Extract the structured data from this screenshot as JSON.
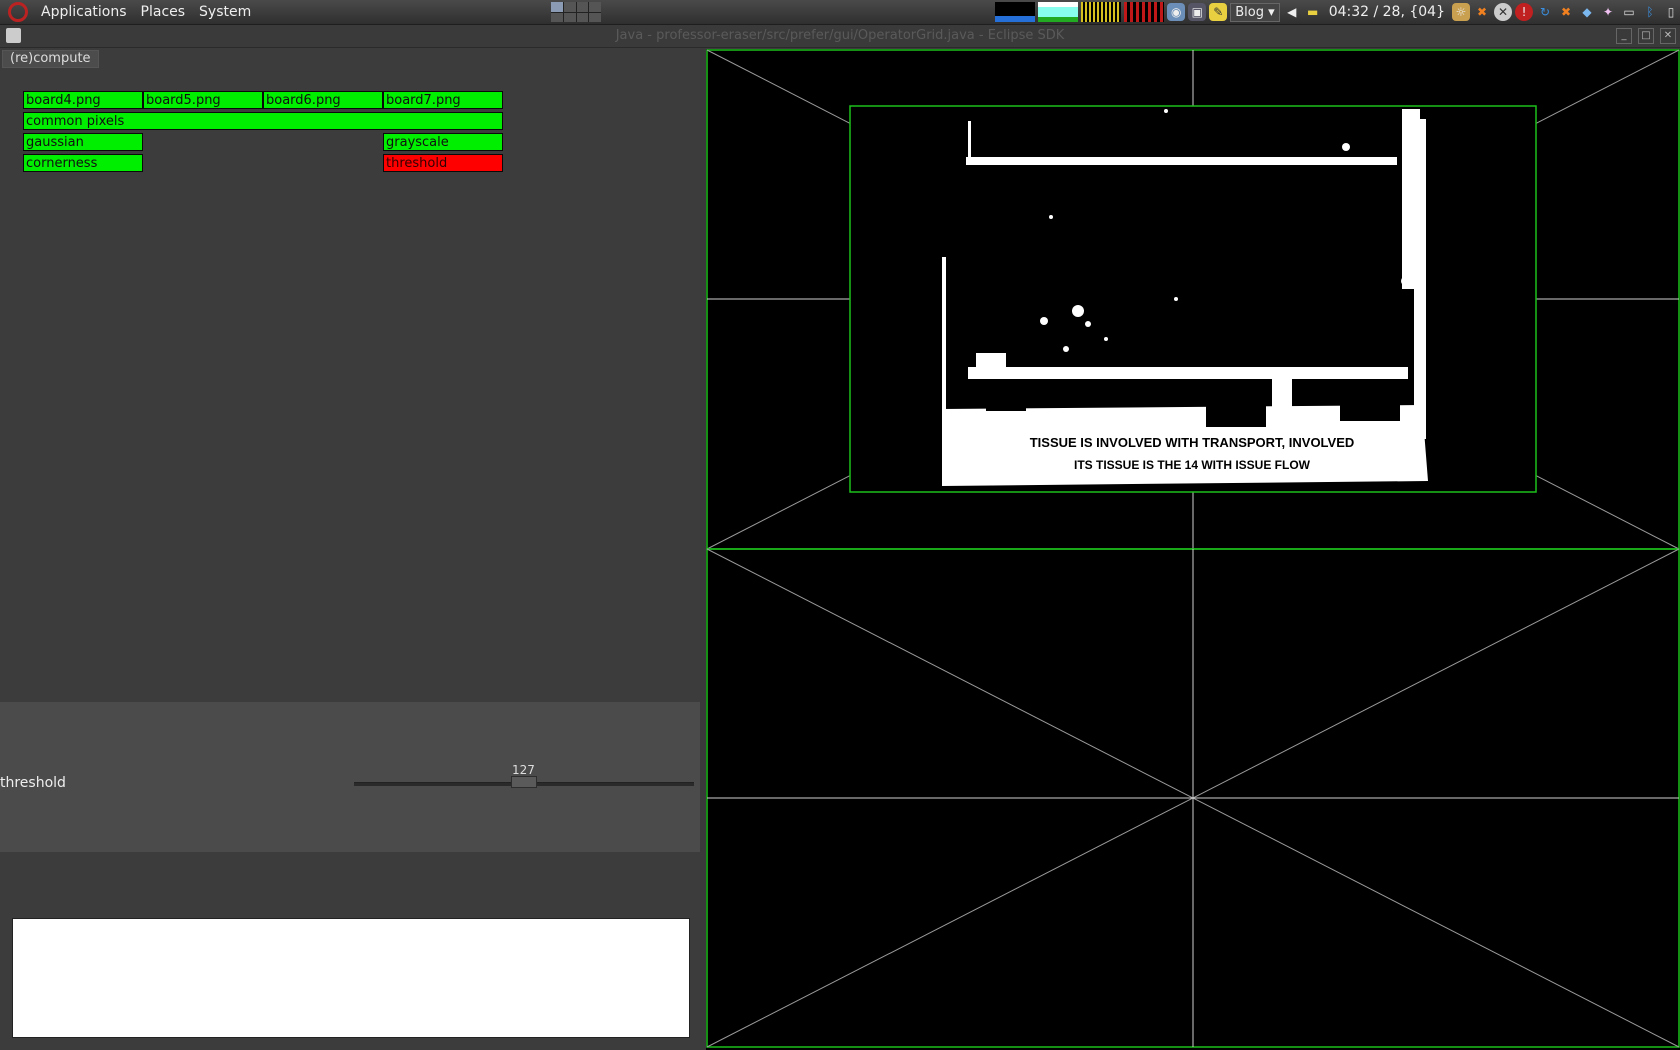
{
  "panel": {
    "menus": [
      "Applications",
      "Places",
      "System"
    ],
    "blog_label": "Blog",
    "clock": "04:32 / 28, {04}"
  },
  "window": {
    "title": "Java - professor-eraser/src/prefer/gui/OperatorGrid.java - Eclipse SDK"
  },
  "toolbar": {
    "recompute_label": "(re)compute"
  },
  "operator_grid": {
    "inputs": [
      "board4.png",
      "board5.png",
      "board6.png",
      "board7.png"
    ],
    "common": "common pixels",
    "gaussian": "gaussian",
    "cornerness": "cornerness",
    "grayscale": "grayscale",
    "threshold": "threshold",
    "ok_color": "#00ee00",
    "error_color": "#ff0000"
  },
  "parameters": {
    "threshold_label": "threshold",
    "threshold_value": "127",
    "threshold_fraction": 0.5
  },
  "image_view": {
    "caption_line1": "TISSUE IS INVOLVED WITH TRANSPORT, INVOLVED",
    "caption_line2": "ITS TISSUE IS THE 14 WITH ISSUE FLOW"
  }
}
